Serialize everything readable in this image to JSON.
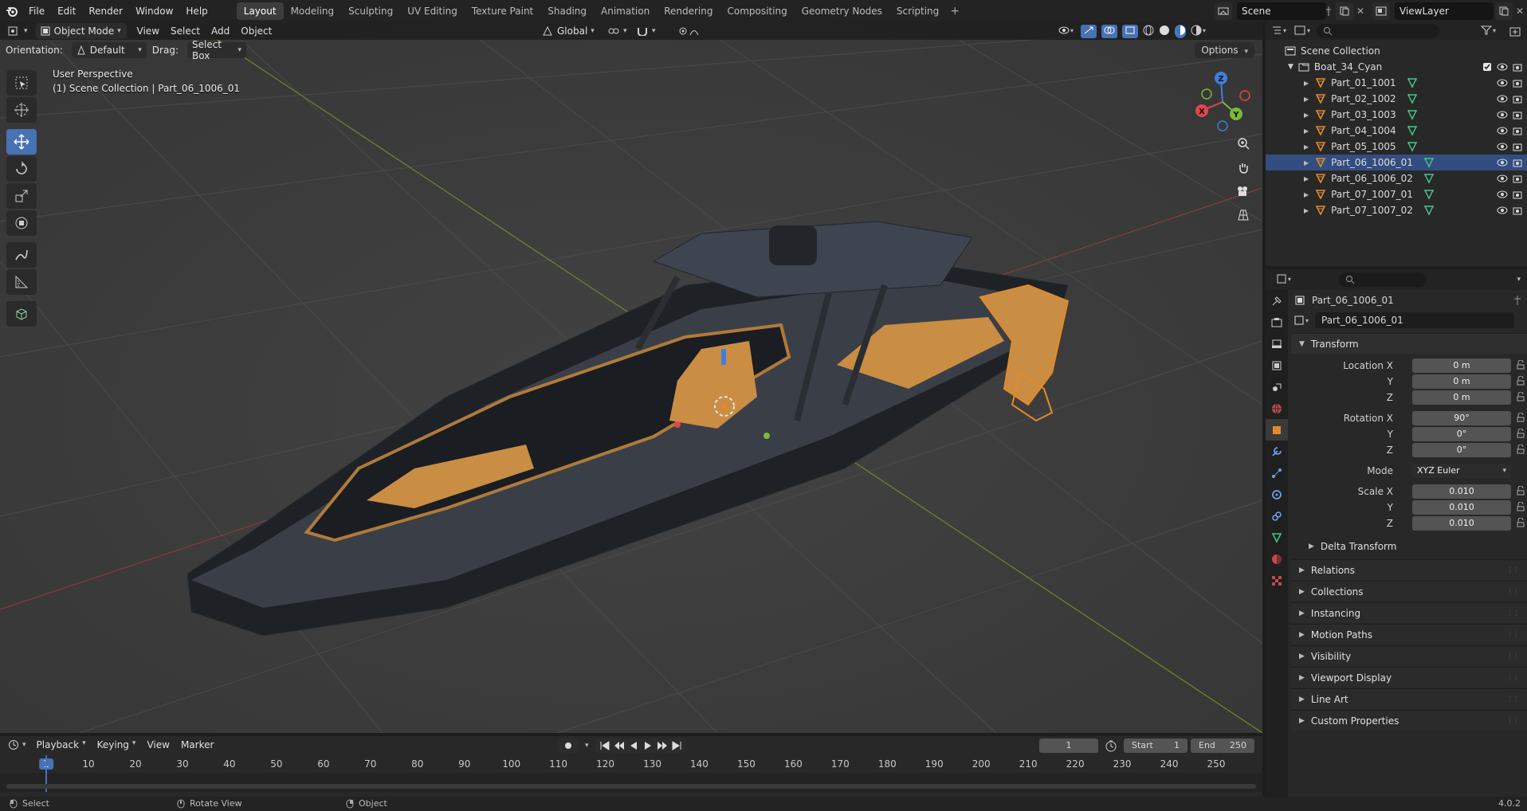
{
  "menu": [
    "File",
    "Edit",
    "Render",
    "Window",
    "Help"
  ],
  "workspaces": [
    "Layout",
    "Modeling",
    "Sculpting",
    "UV Editing",
    "Texture Paint",
    "Shading",
    "Animation",
    "Rendering",
    "Compositing",
    "Geometry Nodes",
    "Scripting"
  ],
  "active_workspace": "Layout",
  "scene": "Scene",
  "view_layer": "ViewLayer",
  "viewport": {
    "mode": "Object Mode",
    "menus": [
      "View",
      "Select",
      "Add",
      "Object"
    ],
    "transform_orientation": "Global",
    "orientation_label": "Orientation:",
    "orientation_value": "Default",
    "drag_label": "Drag:",
    "drag_value": "Select Box",
    "options": "Options",
    "info_line1": "User Perspective",
    "info_line2": "(1) Scene Collection | Part_06_1006_01",
    "gizmo_axes": [
      "X",
      "Y",
      "Z"
    ]
  },
  "outliner": {
    "root": "Scene Collection",
    "collection": "Boat_34_Cyan",
    "items": [
      {
        "name": "Part_01_1001",
        "selected": false
      },
      {
        "name": "Part_02_1002",
        "selected": false
      },
      {
        "name": "Part_03_1003",
        "selected": false
      },
      {
        "name": "Part_04_1004",
        "selected": false
      },
      {
        "name": "Part_05_1005",
        "selected": false
      },
      {
        "name": "Part_06_1006_01",
        "selected": true
      },
      {
        "name": "Part_06_1006_02",
        "selected": false
      },
      {
        "name": "Part_07_1007_01",
        "selected": false
      },
      {
        "name": "Part_07_1007_02",
        "selected": false
      }
    ]
  },
  "properties": {
    "object_name": "Part_06_1006_01",
    "object_field": "Part_06_1006_01",
    "transform_title": "Transform",
    "location": {
      "label": "Location X",
      "x": "0 m",
      "y": "0 m",
      "z": "0 m"
    },
    "rotation": {
      "label": "Rotation X",
      "x": "90°",
      "y": "0°",
      "z": "0°"
    },
    "mode_label": "Mode",
    "mode_value": "XYZ Euler",
    "scale": {
      "label": "Scale X",
      "x": "0.010",
      "y": "0.010",
      "z": "0.010"
    },
    "axis_y": "Y",
    "axis_z": "Z",
    "delta_transform": "Delta Transform",
    "panels": [
      "Relations",
      "Collections",
      "Instancing",
      "Motion Paths",
      "Visibility",
      "Viewport Display",
      "Line Art",
      "Custom Properties"
    ]
  },
  "timeline": {
    "menus": [
      "Playback",
      "Keying",
      "View",
      "Marker"
    ],
    "current_frame": "1",
    "start_label": "Start",
    "start": "1",
    "end_label": "End",
    "end": "250",
    "ticks": [
      "1",
      "10",
      "20",
      "30",
      "40",
      "50",
      "60",
      "70",
      "80",
      "90",
      "100",
      "110",
      "120",
      "130",
      "140",
      "150",
      "160",
      "170",
      "180",
      "190",
      "200",
      "210",
      "220",
      "230",
      "240",
      "250"
    ]
  },
  "statusbar": {
    "select": "Select",
    "rotate": "Rotate View",
    "object": "Object",
    "version": "4.0.2"
  },
  "colors": {
    "accent": "#4772b3",
    "selected_row": "#334d80",
    "object_orange": "#e38a2a",
    "mesh_green": "#47c28c",
    "axis_x": "#e0464b",
    "axis_y": "#7cb83a",
    "axis_z": "#3d7fe0"
  }
}
